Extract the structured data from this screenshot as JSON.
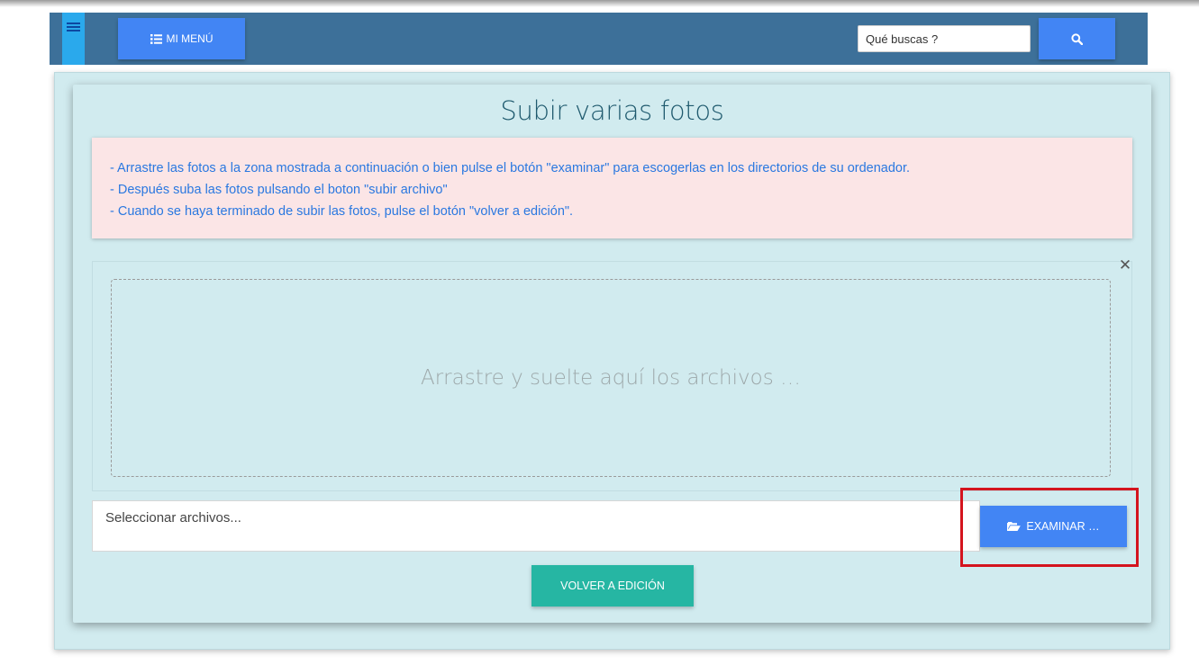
{
  "navbar": {
    "menu_label": "MI MENÚ",
    "menu_icon": "list-icon",
    "toggle_icon": "hamburger-icon",
    "search_placeholder": "Qué buscas ?",
    "search_icon": "search-icon",
    "bg_color": "#3d7099",
    "button_color": "#4285f4"
  },
  "page": {
    "title": "Subir varias fotos"
  },
  "instructions": [
    "- Arrastre las fotos a la zona mostrada a continuación o bien pulse el botón \"examinar\" para escogerlas en los directorios de su ordenador.",
    "- Después suba las fotos pulsando el boton \"subir archivo\"",
    "- Cuando se haya terminado de subir las fotos, pulse el botón \"volver a edición\"."
  ],
  "dropzone": {
    "text": "Arrastre y suelte aquí los archivos …",
    "close_icon": "close-icon"
  },
  "file_input": {
    "placeholder": "Seleccionar archivos..."
  },
  "buttons": {
    "browse_label": "EXAMINAR …",
    "browse_icon": "folder-open-icon",
    "back_label": "VOLVER A EDICIÓN",
    "back_color": "#26b6a3"
  },
  "highlight_color": "#d4141e"
}
